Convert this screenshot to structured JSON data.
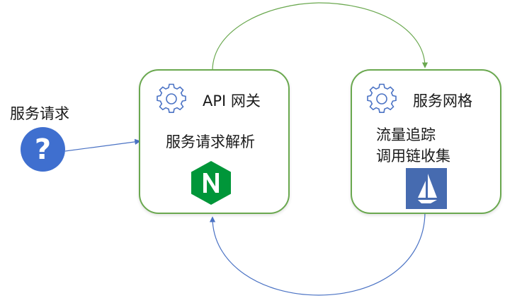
{
  "request": {
    "label": "服务请求",
    "icon": "question-icon",
    "icon_glyph": "?"
  },
  "gateway": {
    "title": "API 网关",
    "subtitle": "服务请求解析",
    "icon": "gear-icon",
    "logo": "nginx-logo"
  },
  "mesh": {
    "title": "服务网格",
    "lines": [
      "流量追踪",
      "调用链收集"
    ],
    "icon": "gear-icon",
    "logo": "istio-logo"
  },
  "colors": {
    "box_border": "#6aa84f",
    "question_fill": "#3f6fcf",
    "arrow_blue": "#4a72c4",
    "arrow_green": "#6aa84f",
    "nginx_green": "#009639",
    "istio_blue": "#466bb0",
    "gear_blue": "#4a72c4"
  }
}
